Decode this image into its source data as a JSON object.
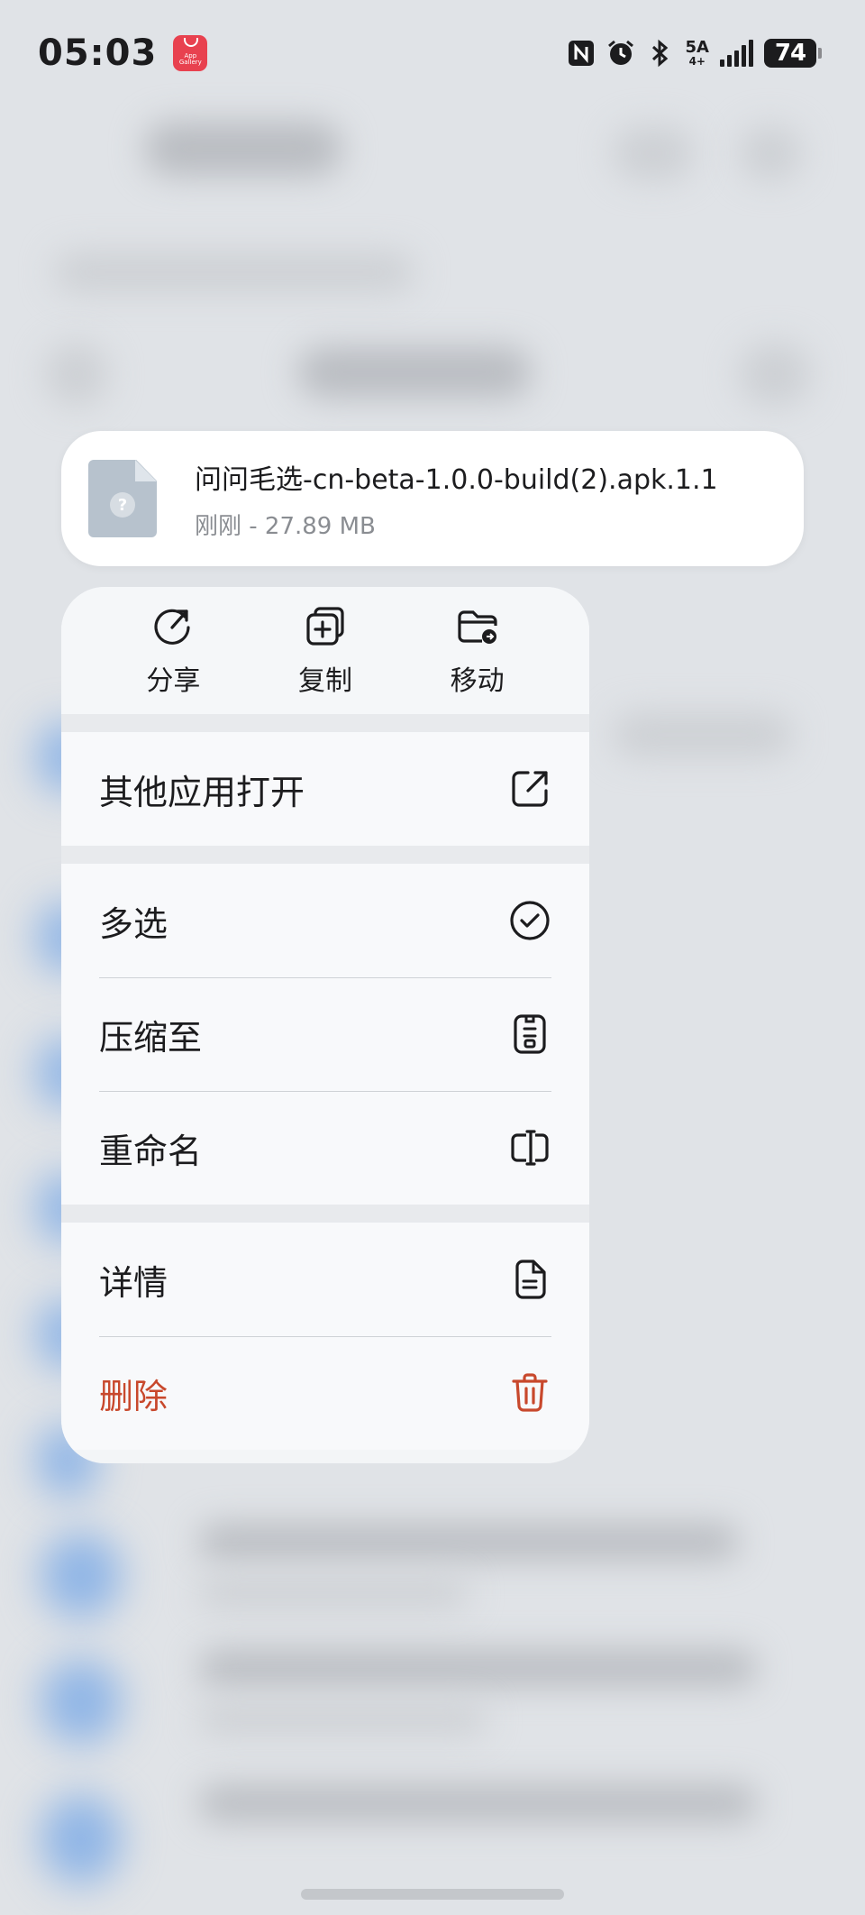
{
  "status_bar": {
    "time": "05:03",
    "app_icon_text": "App Gallery",
    "network": "5A",
    "network_sub": "4+",
    "battery": "74"
  },
  "file_card": {
    "name": "问问毛选-cn-beta-1.0.0-build(2).apk.1.1",
    "meta": "刚刚 - 27.89 MB"
  },
  "menu": {
    "actions": [
      {
        "label": "分享",
        "icon": "share-icon"
      },
      {
        "label": "复制",
        "icon": "copy-icon"
      },
      {
        "label": "移动",
        "icon": "move-icon"
      }
    ],
    "open_with": {
      "label": "其他应用打开",
      "icon": "open-external-icon"
    },
    "multi_select": {
      "label": "多选",
      "icon": "check-circle-icon"
    },
    "compress": {
      "label": "压缩至",
      "icon": "zip-icon"
    },
    "rename": {
      "label": "重命名",
      "icon": "rename-icon"
    },
    "details": {
      "label": "详情",
      "icon": "document-icon"
    },
    "delete": {
      "label": "删除",
      "icon": "trash-icon"
    }
  },
  "colors": {
    "danger": "#c8482c",
    "app_gallery": "#e8414f"
  }
}
